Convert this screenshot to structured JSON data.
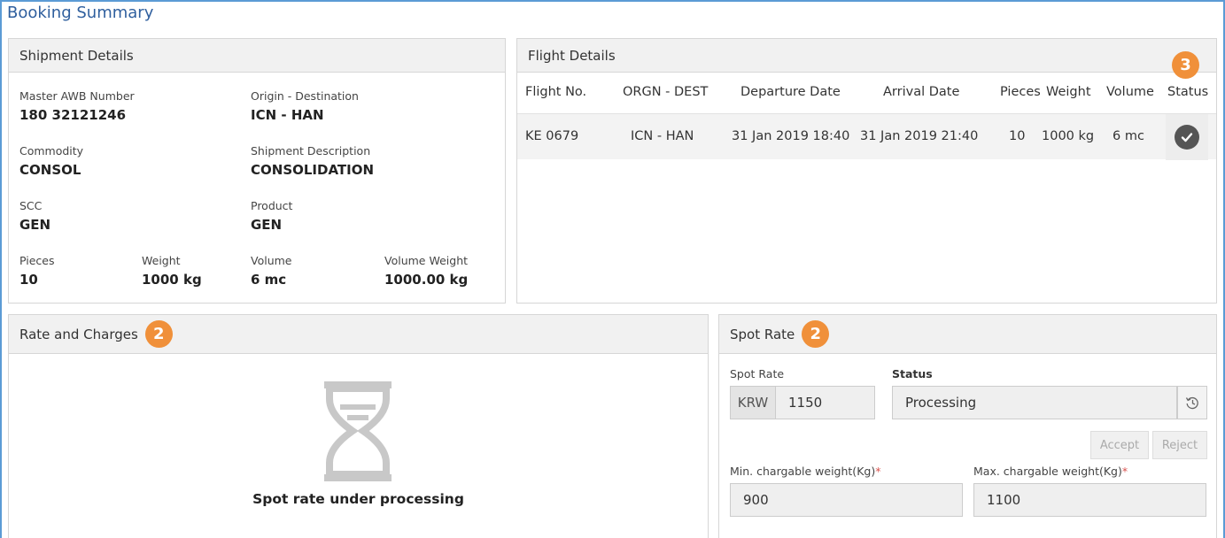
{
  "page_title": "Booking Summary",
  "shipment": {
    "header": "Shipment Details",
    "awb_label": "Master AWB Number",
    "awb_value": "180 32121246",
    "od_label": "Origin - Destination",
    "od_value": "ICN - HAN",
    "commodity_label": "Commodity",
    "commodity_value": "CONSOL",
    "desc_label": "Shipment Description",
    "desc_value": "CONSOLIDATION",
    "scc_label": "SCC",
    "scc_value": "GEN",
    "product_label": "Product",
    "product_value": "GEN",
    "pieces_label": "Pieces",
    "pieces_value": "10",
    "weight_label": "Weight",
    "weight_value": "1000 kg",
    "volume_label": "Volume",
    "volume_value": "6 mc",
    "vweight_label": "Volume Weight",
    "vweight_value": "1000.00 kg"
  },
  "flight": {
    "header": "Flight Details",
    "badge": "3",
    "columns": [
      "Flight No.",
      "ORGN - DEST",
      "Departure Date",
      "Arrival Date",
      "Pieces",
      "Weight",
      "Volume",
      "Status"
    ],
    "rows": [
      {
        "flight_no": "KE 0679",
        "orgn_dest": "ICN - HAN",
        "departure": "31 Jan 2019 18:40",
        "arrival": "31 Jan 2019 21:40",
        "pieces": "10",
        "weight": "1000 kg",
        "volume": "6 mc",
        "status_icon": "check-circle-icon"
      }
    ]
  },
  "rates": {
    "header": "Rate and Charges",
    "badge": "2",
    "message": "Spot rate under processing",
    "icon": "hourglass-icon"
  },
  "spot_rate": {
    "header": "Spot Rate",
    "badge": "2",
    "rate_label": "Spot Rate",
    "currency": "KRW",
    "rate_value": "1150",
    "status_label": "Status",
    "status_value": "Processing",
    "history_icon": "history-icon",
    "accept_label": "Accept",
    "reject_label": "Reject",
    "min_label": "Min. chargable weight(Kg)",
    "min_value": "900",
    "max_label": "Max. chargable weight(Kg)",
    "max_value": "1100",
    "required_mark": "*"
  },
  "colors": {
    "badge": "#f0903a",
    "title": "#2f5f9e",
    "frame": "#5b9bd5"
  }
}
